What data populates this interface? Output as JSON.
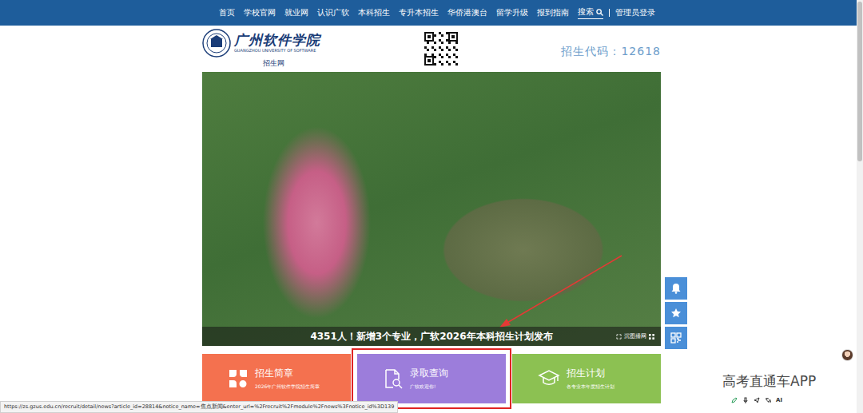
{
  "nav": {
    "items": [
      "首页",
      "学校官网",
      "就业网",
      "认识广软",
      "本科招生",
      "专升本招生",
      "华侨港澳台",
      "留学升级",
      "报到指南"
    ],
    "search": "搜索",
    "login": "管理员登录"
  },
  "header": {
    "logo_name": "广州软件学院",
    "logo_english": "GUANGZHOU UNIVERSITY OF SOFTWARE",
    "site": "招生网",
    "code": "招生代码：12618"
  },
  "hero": {
    "caption": "4351人！新增3个专业，广软2026年本科招生计划发布",
    "action": "沉图播网"
  },
  "cards": [
    {
      "title": "招生简章",
      "subtitle": "2026年广州软件学院招生简章",
      "color": "#f4714f",
      "highlighted": false,
      "icon": "leaf"
    },
    {
      "title": "录取查询",
      "subtitle": "广软欢迎你!",
      "color": "#9c7ddb",
      "highlighted": true,
      "icon": "search-doc"
    },
    {
      "title": "招生计划",
      "subtitle": "各专业本年度招生计划",
      "color": "#8cc152",
      "highlighted": false,
      "icon": "cap"
    }
  ],
  "watermark": "高考直通车APP",
  "toolbar": {
    "ai": "AI"
  },
  "status_url": "https://zs.gzus.edu.cn/recruit/detail/news?article_id=28814&notice_name=焦点新闻&enter_url=%2Frecruit%2Fmodule%2Fnews%3Fnotice_id%3D139"
}
